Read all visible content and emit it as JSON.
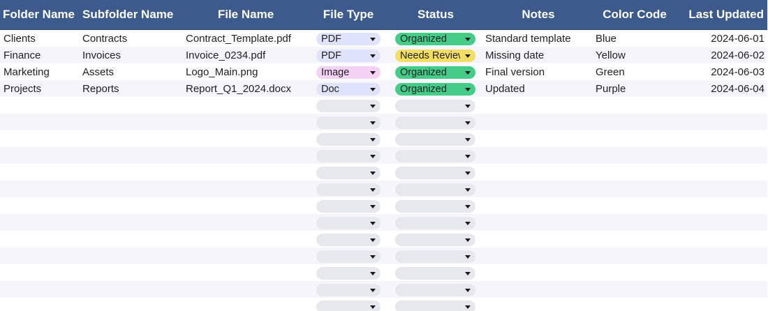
{
  "headers": {
    "folder_name": "Folder Name",
    "subfolder_name": "Subfolder Name",
    "file_name": "File Name",
    "file_type": "File Type",
    "status": "Status",
    "notes": "Notes",
    "color_code": "Color Code",
    "last_updated": "Last Updated"
  },
  "rows": [
    {
      "folder": "Clients",
      "subfolder": "Contracts",
      "file": "Contract_Template.pdf",
      "file_type": "PDF",
      "status": "Organized",
      "notes": "Standard template",
      "color_code": "Blue",
      "updated": "2024-06-01"
    },
    {
      "folder": "Finance",
      "subfolder": "Invoices",
      "file": "Invoice_0234.pdf",
      "file_type": "PDF",
      "status": "Needs Review",
      "notes": "Missing date",
      "color_code": "Yellow",
      "updated": "2024-06-02"
    },
    {
      "folder": "Marketing",
      "subfolder": "Assets",
      "file": "Logo_Main.png",
      "file_type": "Image",
      "status": "Organized",
      "notes": "Final version",
      "color_code": "Green",
      "updated": "2024-06-03"
    },
    {
      "folder": "Projects",
      "subfolder": "Reports",
      "file": "Report_Q1_2024.docx",
      "file_type": "Doc",
      "status": "Organized",
      "notes": "Updated",
      "color_code": "Purple",
      "updated": "2024-06-04"
    }
  ],
  "chip_colors": {
    "file_type": {
      "PDF": "#dfe3fb",
      "Image": "#f6d2f7",
      "Doc": "#dfe3fb",
      "empty": "#e7e7ee"
    },
    "status": {
      "Organized": "#44cc88",
      "Needs Review": "#f1de62",
      "empty": "#e7e7ee"
    }
  },
  "colors": {
    "header_bg": "#3c5a8c",
    "header_text": "#ffffff",
    "row_stripe": "#f6f5fb"
  }
}
